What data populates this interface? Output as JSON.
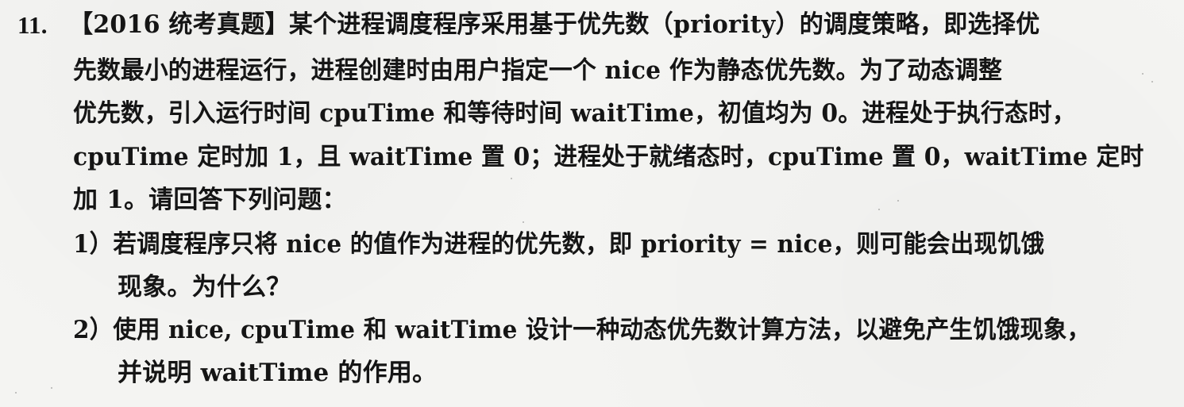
{
  "question": {
    "number": "11.",
    "lines": [
      "【2016 统考真题】某个进程调度程序采用基于优先数（priority）的调度策略，即选择优",
      "先数最小的进程运行，进程创建时由用户指定一个 nice 作为静态优先数。为了动态调整",
      "优先数，引入运行时间 cpuTime 和等待时间 waitTime，初值均为 0。进程处于执行态时，",
      "cpuTime 定时加 1，且 waitTime 置 0；进程处于就绪态时，cpuTime 置 0，waitTime 定时",
      "加 1。请回答下列问题：",
      "1）若调度程序只将 nice 的值作为进程的优先数，即 priority = nice，则可能会出现饥饿",
      "现象。为什么？",
      "2）使用 nice, cpuTime 和 waitTime 设计一种动态优先数计算方法，以避免产生饥饿现象，",
      "并说明 waitTime 的作用。"
    ]
  }
}
